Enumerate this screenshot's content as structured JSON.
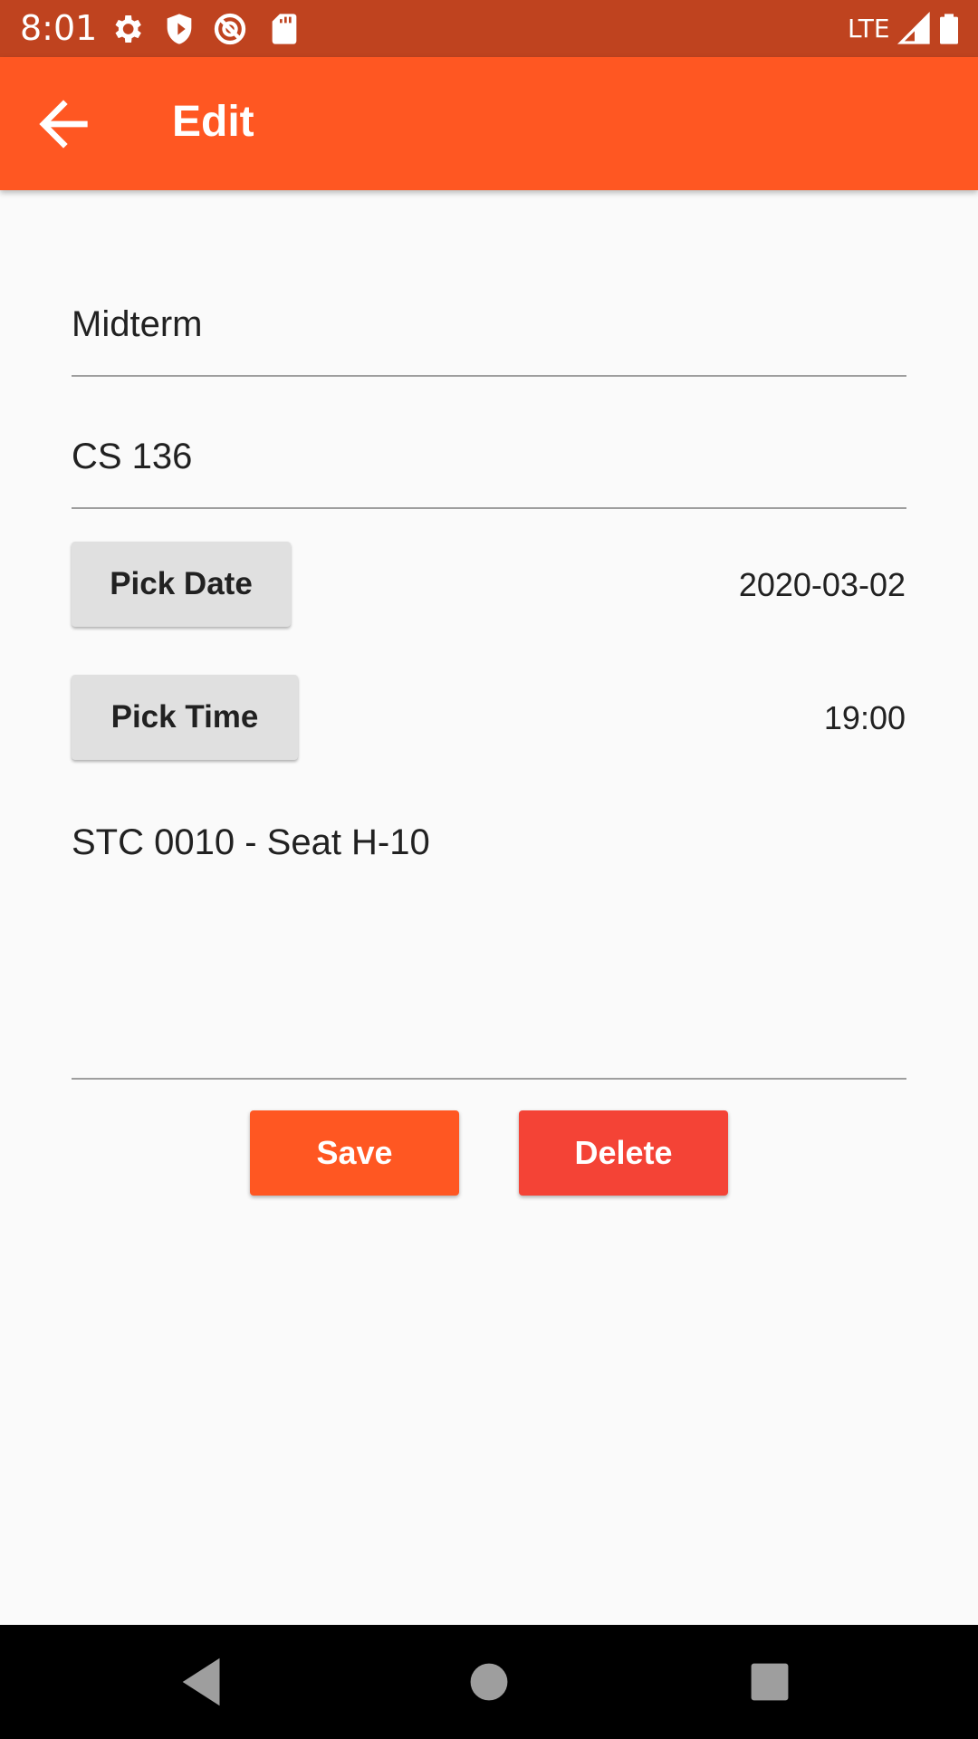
{
  "status_bar": {
    "time": "8:01",
    "network": "LTE",
    "icons": [
      "settings-icon",
      "shield-icon",
      "do-not-disturb-icon",
      "sd-card-icon",
      "signal-icon",
      "battery-icon"
    ]
  },
  "app_bar": {
    "title": "Edit",
    "back_icon": "arrow-back-icon"
  },
  "form": {
    "title_value": "Midterm",
    "course_value": "CS 136",
    "pick_date_label": "Pick Date",
    "date_value": "2020-03-02",
    "pick_time_label": "Pick Time",
    "time_value": "19:00",
    "location_value": "STC 0010 - Seat H-10"
  },
  "actions": {
    "save_label": "Save",
    "delete_label": "Delete"
  },
  "nav_bar": {
    "icons": [
      "back-triangle-icon",
      "home-circle-icon",
      "recents-square-icon"
    ]
  },
  "colors": {
    "status_bar": "#bf431f",
    "app_bar": "#ff5722",
    "save": "#ff5722",
    "delete": "#f44336",
    "background": "#fafafa"
  }
}
